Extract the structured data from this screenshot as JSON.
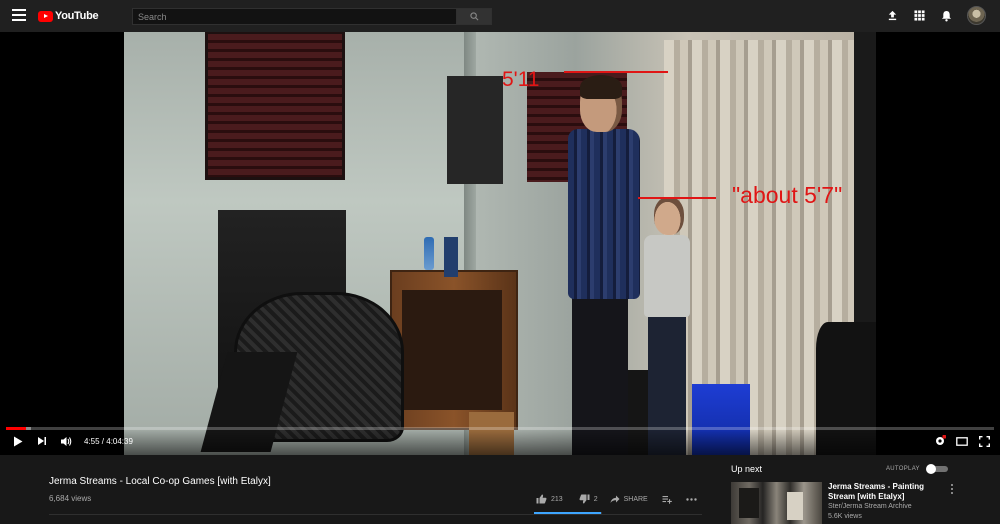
{
  "header": {
    "logo_text": "YouTube",
    "search_placeholder": "Search"
  },
  "player": {
    "annotations": {
      "height_1": "5'11",
      "height_2": "\"about 5'7\""
    },
    "current_time": "4:55",
    "duration": "4:04:39",
    "time_display": "4:55 / 4:04:39",
    "progress_fraction": 0.02,
    "loaded_fraction": 0.025
  },
  "video": {
    "title": "Jerma Streams - Local Co-op Games [with Etalyx]",
    "views": "6,684 views",
    "likes": "213",
    "dislikes": "2",
    "share_label": "SHARE",
    "like_ratio": 0.99
  },
  "sidebar": {
    "up_next_label": "Up next",
    "autoplay_label": "AUTOPLAY",
    "next_video": {
      "title": "Jerma Streams - Painting Stream [with Etalyx]",
      "channel": "Ster/Jerma Stream Archive",
      "views": "5.6K views"
    }
  },
  "colors": {
    "accent": "#ff0000",
    "annotation": "#e01515",
    "like_bar": "#3ea6ff",
    "background": "#181818"
  },
  "icons": [
    "menu-icon",
    "youtube-logo-icon",
    "search-icon",
    "upload-icon",
    "apps-icon",
    "bell-icon",
    "play-icon",
    "next-icon",
    "volume-icon",
    "settings-icon",
    "theater-icon",
    "fullscreen-icon",
    "like-icon",
    "dislike-icon",
    "share-icon",
    "add-to-playlist-icon",
    "more-icon"
  ]
}
